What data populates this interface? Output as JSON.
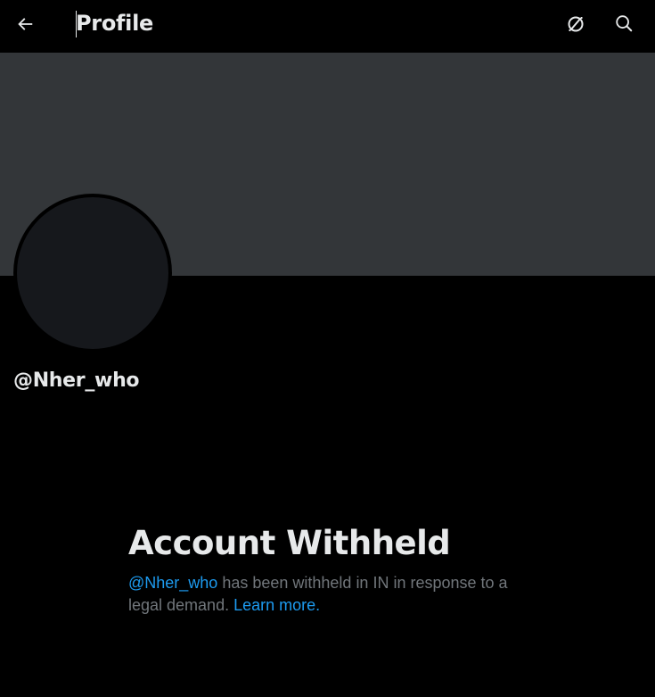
{
  "header": {
    "title": "Profile",
    "back_icon": "arrow-left-icon",
    "sync_icon": "circle-slash-sync-icon",
    "search_icon": "search-icon"
  },
  "profile": {
    "handle": "@Nher_who"
  },
  "withheld": {
    "title": "Account Withheld",
    "handle_link": "@Nher_who",
    "message": " has been withheld in IN in response to a legal demand. ",
    "learn_more": "Learn more."
  },
  "colors": {
    "background": "#000000",
    "banner": "#333639",
    "avatar": "#16181c",
    "text_primary": "#e7e9ea",
    "text_secondary": "#71767b",
    "link": "#1d9bf0"
  }
}
